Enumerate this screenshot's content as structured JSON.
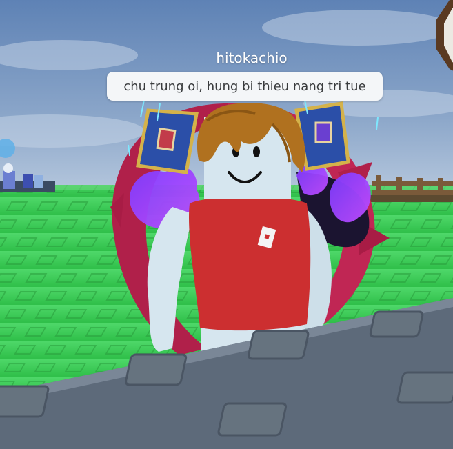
{
  "player": {
    "username": "hitokachio",
    "chat_message": "chu trung oi, hung bi thieu nang tri tue"
  },
  "icons": {
    "shirt_logo": "roblox-logo-icon",
    "corner_control": "menu-button-icon"
  },
  "colors": {
    "sky": "#6f8fb8",
    "grass": "#3fd25a",
    "shirt": "#cc2f30",
    "skin": "#d6e6ef",
    "hair": "#b0711f",
    "aura": "#b0204a",
    "bubble": "#f4f6f8"
  }
}
